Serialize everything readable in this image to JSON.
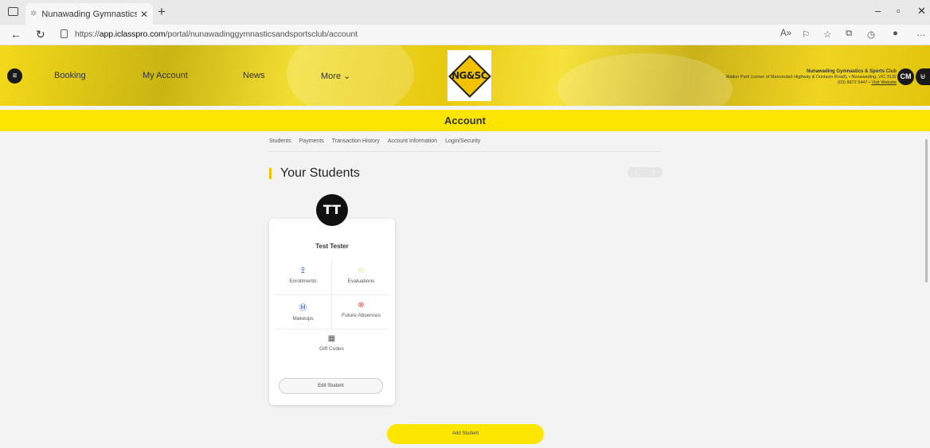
{
  "browser": {
    "tab_title": "Nunawading Gymnastics & Spor",
    "url_prefix": "https://",
    "url_domain": "app.iclasspro.com",
    "url_path": "/portal/nunawadinggymnasticsandsportsclub/account"
  },
  "header": {
    "menu_icon": "≡",
    "nav": [
      "Booking",
      "My Account",
      "News",
      "More ⌄"
    ],
    "logo_text": "NG&SC",
    "club_name": "Nunawading Gymnastics & Sports Club",
    "address": "Walker Park (corner of Maroondah Highway & Dunlavin Road), • Nunawading, VIC 3132",
    "phone": "(03) 9872 5447 •",
    "visit": "Visit Website",
    "user_initials": "CM",
    "cart_glyph": "⊌"
  },
  "page": {
    "band_title": "Account",
    "subnav": [
      "Students",
      "Payments",
      "Transaction History",
      "Account Information",
      "Login/Security"
    ],
    "section_title": "Your Students"
  },
  "student": {
    "initials": "TT",
    "name": "Test Tester",
    "actions": [
      "Enrollments",
      "Evaluations",
      "Makeups",
      "Future Absences",
      "Gift Codes"
    ],
    "edit_label": "Edit Student"
  },
  "add_student_label": "Add Student",
  "colors": {
    "brand_yellow": "#fce600",
    "enrollments_icon": "#4a7fd6",
    "evaluations_icon": "#f2c200",
    "makeups_icon": "#3b5ccc",
    "absences_icon": "#e05454"
  },
  "icons": {
    "enrollments": "users-icon",
    "evaluations": "star-icon",
    "makeups": "makeup-icon",
    "future_absences": "cancel-circle-icon",
    "gift_codes": "qr-code-icon"
  }
}
